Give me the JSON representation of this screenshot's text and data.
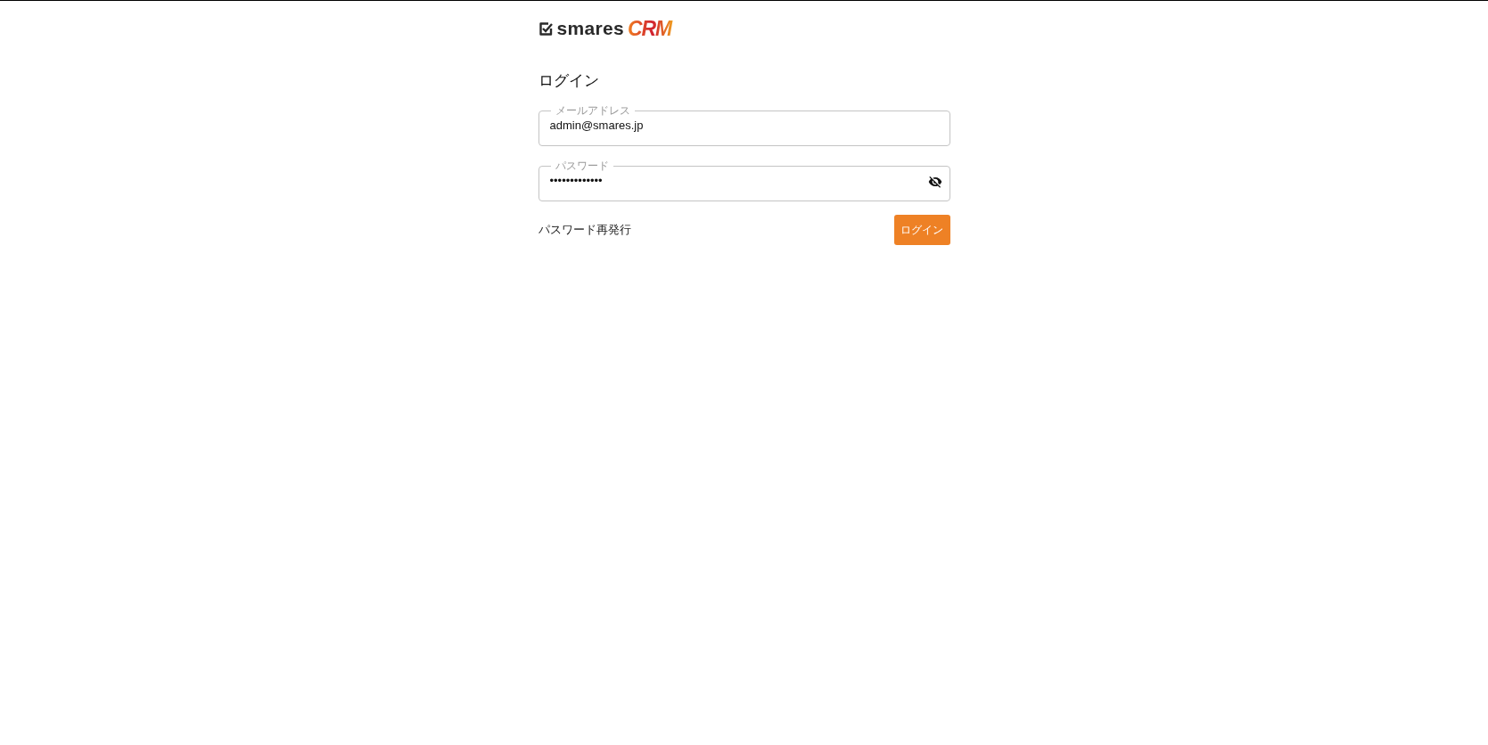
{
  "logo": {
    "word": "smares",
    "accent": "CRM"
  },
  "title": "ログイン",
  "fields": [
    {
      "kind": "text",
      "label": "メールアドレス",
      "value": "admin@smares.jp"
    },
    {
      "kind": "password",
      "label": "パスワード",
      "value": "•••••••••••••",
      "revealed": false
    }
  ],
  "reset_link": "パスワード再発行",
  "submit_button": "ログイン"
}
